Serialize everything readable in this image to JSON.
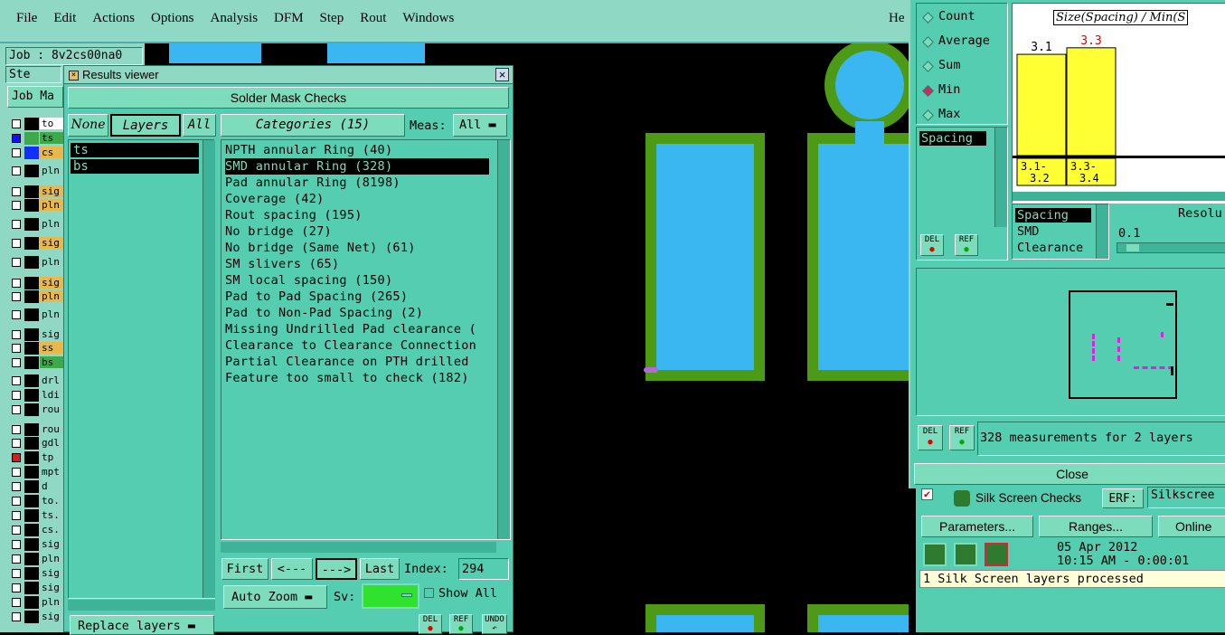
{
  "menu": [
    "File",
    "Edit",
    "Actions",
    "Options",
    "Analysis",
    "DFM",
    "Step",
    "Rout",
    "Windows"
  ],
  "menu_right": "He",
  "job_label": "Job : 8v2cs00na0",
  "step_label": "Ste",
  "job_matrix_btn": "Job Ma",
  "layer_list": [
    {
      "name": "to",
      "color": "#ffffff"
    },
    {
      "name": "ts",
      "color": "#3ea94a"
    },
    {
      "name": "cs",
      "color": "#e9b84a"
    },
    {
      "name": "pln",
      "color": "#8fd8c4"
    },
    {
      "name": "sig",
      "color": "#e9b84a"
    },
    {
      "name": "pln",
      "color": "#e9b84a"
    },
    {
      "name": "pln",
      "color": "#8fd8c4"
    },
    {
      "name": "sig",
      "color": "#e9b84a"
    },
    {
      "name": "pln",
      "color": "#8fd8c4"
    },
    {
      "name": "sig",
      "color": "#e9b84a"
    },
    {
      "name": "pln",
      "color": "#e9b84a"
    },
    {
      "name": "pln",
      "color": "#8fd8c4"
    },
    {
      "name": "sig",
      "color": "#8fd8c4"
    },
    {
      "name": "ss",
      "color": "#e9b84a"
    },
    {
      "name": "bs",
      "color": "#3ea94a"
    },
    {
      "name": "drl",
      "color": "#8fd8c4"
    },
    {
      "name": "ldi",
      "color": "#8fd8c4"
    },
    {
      "name": "rou",
      "color": "#8fd8c4"
    },
    {
      "name": "rou",
      "color": "#8fd8c4"
    },
    {
      "name": "gdl",
      "color": "#8fd8c4"
    },
    {
      "name": "tp",
      "color": "#8fd8c4"
    },
    {
      "name": "mpt",
      "color": "#8fd8c4"
    },
    {
      "name": "d",
      "color": "#8fd8c4"
    },
    {
      "name": "to.",
      "color": "#8fd8c4"
    },
    {
      "name": "ts.",
      "color": "#8fd8c4"
    },
    {
      "name": "cs.",
      "color": "#8fd8c4"
    },
    {
      "name": "sig",
      "color": "#8fd8c4"
    },
    {
      "name": "pln",
      "color": "#8fd8c4"
    },
    {
      "name": "sig",
      "color": "#8fd8c4"
    },
    {
      "name": "sig",
      "color": "#8fd8c4"
    },
    {
      "name": "pln",
      "color": "#8fd8c4"
    },
    {
      "name": "sig",
      "color": "#8fd8c4"
    }
  ],
  "results_viewer": {
    "title": "Results viewer",
    "header": "Solder Mask Checks",
    "none_btn": "None",
    "layers_btn": "Layers",
    "all_btn": "All",
    "layers": [
      "ts",
      "bs"
    ],
    "categories_btn": "Categories (15)",
    "meas_label": "Meas:",
    "meas_value": "All",
    "categories": [
      "NPTH annular Ring (40)",
      "SMD annular Ring (328)",
      "Pad annular Ring (8198)",
      "Coverage (42)",
      "Rout spacing (195)",
      "No bridge (27)",
      "No bridge (Same Net) (61)",
      "SM slivers (65)",
      "SM local spacing (150)",
      "Pad to Pad Spacing (265)",
      "Pad to Non-Pad Spacing (2)",
      "Missing Undrilled Pad clearance (",
      "Clearance to Clearance Connection",
      "Partial Clearance on PTH drilled",
      "Feature too small to check (182)"
    ],
    "selected_category": 1,
    "first_btn": "First",
    "prev_btn": "<---",
    "next_btn": "--->",
    "last_btn": "Last",
    "index_label": "Index:",
    "index_value": "294",
    "auto_zoom": "Auto Zoom",
    "sv_label": "Sv:",
    "show_all": "Show All",
    "replace_layers": "Replace layers",
    "del": "DEL",
    "ref": "REF",
    "undo": "UNDO"
  },
  "stats": {
    "options": [
      "Count",
      "Average",
      "Sum",
      "Min",
      "Max"
    ],
    "selected": "Min",
    "chart_title": "Size(Spacing) / Min(S",
    "list1": [
      "Spacing"
    ],
    "list2": [
      "Spacing",
      "SMD",
      "Clearance"
    ],
    "resolution_label": "Resolu",
    "resolution_value": "0.1",
    "summary": "328 measurements for 2 layers",
    "close": "Close",
    "del": "DEL",
    "ref": "REF"
  },
  "chart_data": {
    "type": "bar",
    "title": "Size(Spacing) / Min(S",
    "categories": [
      "3.1-\n3.2",
      "3.3-\n3.4"
    ],
    "values": [
      3.1,
      3.3
    ],
    "value_labels": [
      "3.1",
      "3.3"
    ],
    "colors": [
      "#ffff33",
      "#ffff33"
    ],
    "label_colors": [
      "#000000",
      "#e00000"
    ],
    "ylim": [
      0,
      3.6
    ]
  },
  "silk": {
    "title": "Silk Screen Checks",
    "erf_label": "ERF:",
    "erf_value": "Silkscree",
    "parameters": "Parameters...",
    "ranges": "Ranges...",
    "online": "Online",
    "date": "05 Apr 2012",
    "time": "10:15 AM - 0:00:01",
    "status": "1 Silk Screen layers processed"
  }
}
